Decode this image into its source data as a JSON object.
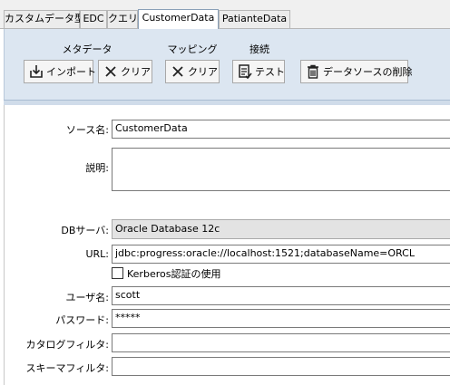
{
  "tabs": [
    {
      "label": "カスタムデータ型"
    },
    {
      "label": "EDC"
    },
    {
      "label": "クエリ"
    },
    {
      "label": "CustomerData"
    },
    {
      "label": "PatianteData"
    }
  ],
  "ribbon": {
    "groups": {
      "metadata": "メタデータ",
      "mapping": "マッピング",
      "connection": "接続"
    },
    "buttons": {
      "import": "インポート",
      "clear_metadata": "クリア",
      "clear_mapping": "クリア",
      "test": "テスト",
      "delete_source": "データソースの削除"
    }
  },
  "form": {
    "source_name_label": "ソース名:",
    "source_name_value": "CustomerData",
    "description_label": "説明:",
    "description_value": "",
    "db_server_label": "DBサーバ:",
    "db_server_value": "Oracle Database 12c",
    "url_label": "URL:",
    "url_value": "jdbc:progress:oracle://localhost:1521;databaseName=ORCL",
    "kerberos_label": "Kerberos認証の使用",
    "username_label": "ユーザ名:",
    "username_value": "scott",
    "password_label": "パスワード:",
    "password_value": "*****",
    "catalog_filter_label": "カタログフィルタ:",
    "catalog_filter_value": "",
    "schema_filter_label": "スキーマフィルタ:",
    "schema_filter_value": ""
  }
}
